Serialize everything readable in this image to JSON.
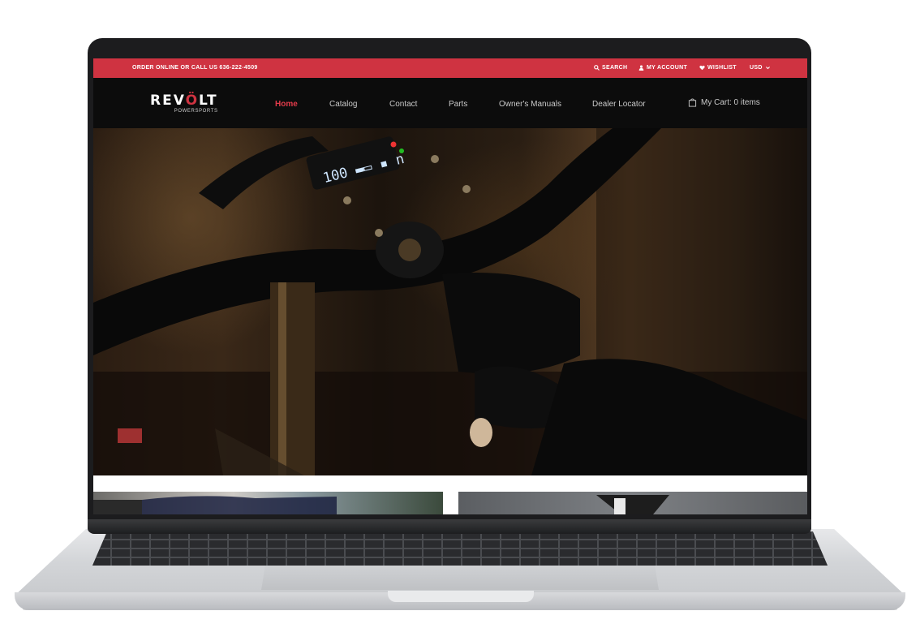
{
  "topbar": {
    "promo": "ORDER ONLINE OR CALL US 636-222-4509",
    "search_label": "SEARCH",
    "account_label": "MY ACCOUNT",
    "wishlist_label": "WISHLIST",
    "currency": "USD"
  },
  "brand": {
    "logo_text_1": "REV",
    "logo_text_2": "Ö",
    "logo_text_3": "LT",
    "tagline": "POWERSPORTS"
  },
  "nav": {
    "home": "Home",
    "catalog": "Catalog",
    "contact": "Contact",
    "parts": "Parts",
    "manuals": "Owner's Manuals",
    "dealer": "Dealer Locator"
  },
  "cart": {
    "label": "My Cart: 0 items"
  },
  "colors": {
    "accent": "#cf3341",
    "nav_bg": "#0c0c0c"
  },
  "icons": {
    "search": "search-icon",
    "account": "user-icon",
    "wishlist": "heart-icon",
    "currency": "chevron-down-icon",
    "cart": "shopping-bag-icon"
  }
}
